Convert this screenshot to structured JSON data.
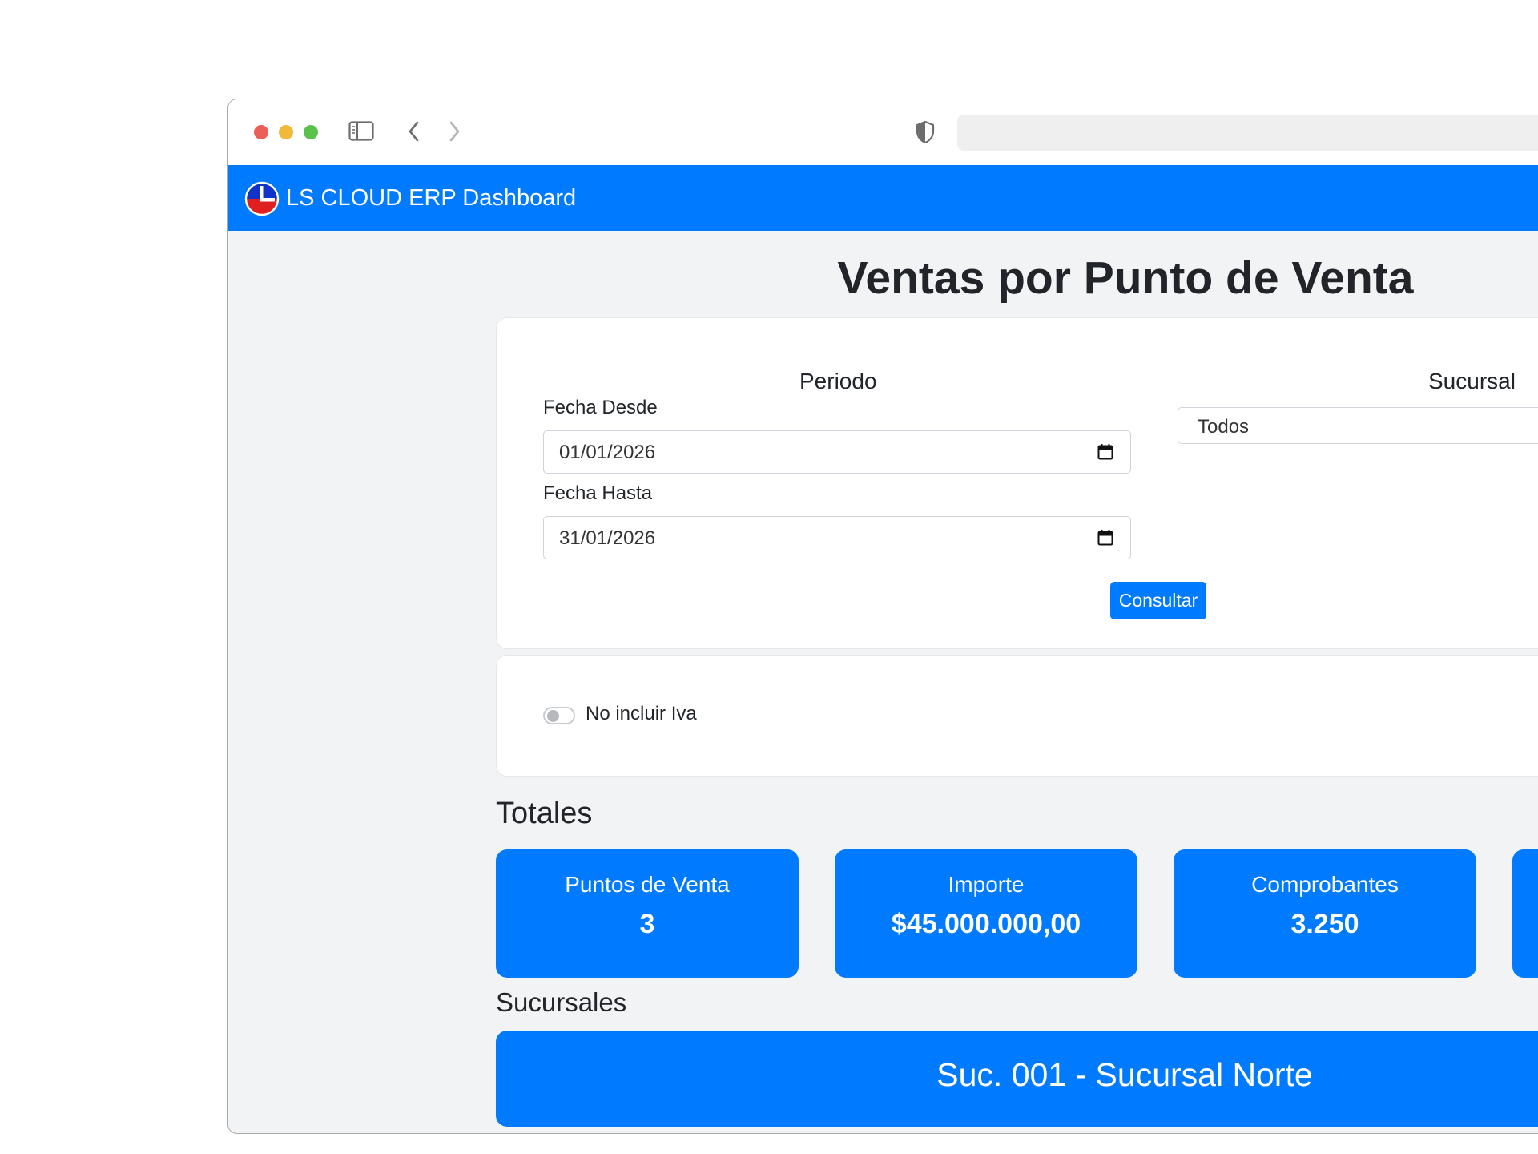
{
  "navbar": {
    "brand": "LS CLOUD ERP Dashboard"
  },
  "page": {
    "title": "Ventas por Punto de Venta"
  },
  "filters": {
    "periodo_title": "Periodo",
    "fecha_desde_label": "Fecha Desde",
    "fecha_desde_value": "01/01/2026",
    "fecha_hasta_label": "Fecha Hasta",
    "fecha_hasta_value": "31/01/2026",
    "sucursal_title": "Sucursal",
    "sucursal_selected": "Todos",
    "consultar_label": "Consultar"
  },
  "options": {
    "no_iva_label": "No incluir Iva",
    "no_iva_checked": false
  },
  "totales": {
    "title": "Totales",
    "cards": [
      {
        "label": "Puntos de Venta",
        "value": "3"
      },
      {
        "label": "Importe",
        "value": "$45.000.000,00"
      },
      {
        "label": "Comprobantes",
        "value": "3.250"
      }
    ]
  },
  "sucursales": {
    "title": "Sucursales",
    "items": [
      {
        "name": "Suc. 001 - Sucursal Norte"
      }
    ]
  },
  "icons": {
    "window_controls": [
      "close-dot",
      "minimize-dot",
      "maximize-dot"
    ],
    "toolbar": [
      "sidebar-icon",
      "back-icon",
      "forward-icon",
      "shield-icon"
    ],
    "calendar": "calendar-icon",
    "logo": "ls-logo-icon"
  },
  "colors": {
    "primary": "#007bff",
    "page_background": "#f1f3f5",
    "card_background": "#ffffff",
    "close": "#ec5f57",
    "minimize": "#f1b93a",
    "maximize": "#5bc14d"
  }
}
